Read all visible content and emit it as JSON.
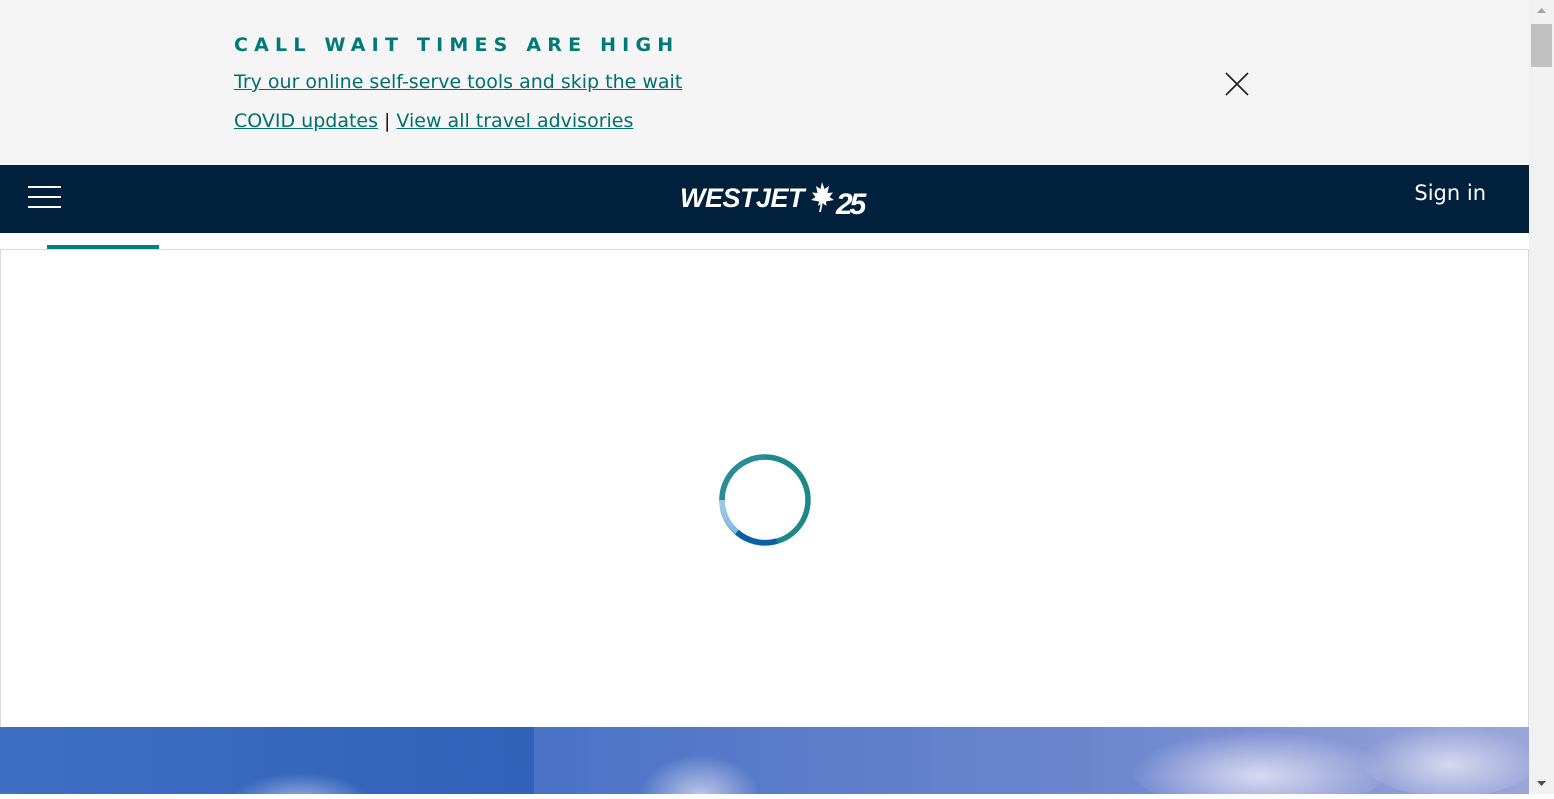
{
  "alert": {
    "heading": "CALL WAIT TIMES ARE HIGH",
    "self_serve_link": "Try our online self-serve tools and skip the wait",
    "covid_link": "COVID updates",
    "separator": "|",
    "advisories_link": "View all travel advisories"
  },
  "header": {
    "logo_text": "WESTJET",
    "logo_anniversary": "25",
    "sign_in_label": "Sign in"
  },
  "colors": {
    "alert_accent": "#007a78",
    "header_bg": "#00203b",
    "tab_indicator": "#00827e",
    "spinner_primary": "#1a8a88",
    "spinner_secondary": "#7fb8e0"
  },
  "icons": {
    "close": "close-icon",
    "menu": "hamburger-menu-icon",
    "spinner": "loading-spinner-icon",
    "maple_leaf": "maple-leaf-icon"
  }
}
